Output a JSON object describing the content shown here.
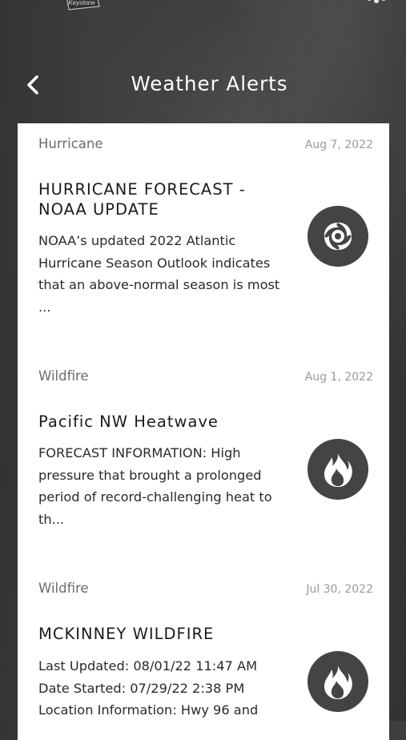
{
  "header": {
    "title": "Weather Alerts",
    "back_icon": "chevron-left-icon",
    "logo_text": "Keystone",
    "settings_icon": "gear-icon"
  },
  "colors": {
    "background": "#3a3c3e",
    "card": "#ffffff",
    "icon_circle": "#424446",
    "category_text": "#6b6b6b",
    "date_text": "#9a9a9a"
  },
  "alerts": [
    {
      "category": "Hurricane",
      "date": "Aug 7, 2022",
      "title": "HURRICANE FORECAST - NOAA UPDATE",
      "body": "NOAA’s updated 2022 Atlantic Hurricane Season Outlook indicates that an above-normal season is most ...",
      "icon": "hurricane-icon"
    },
    {
      "category": "Wildfire",
      "date": "Aug 1, 2022",
      "title": "Pacific NW Heatwave",
      "body": "FORECAST INFORMATION: High pressure that brought a prolonged period of record-challenging heat to th...",
      "icon": "fire-icon"
    },
    {
      "category": "Wildfire",
      "date": "Jul 30, 2022",
      "title": "MCKINNEY WILDFIRE",
      "body_lines": [
        "Last Updated: 08/01/22 11:47 AM",
        "Date Started: 07/29/22 2:38 PM",
        "Location Information: Hwy 96 and"
      ],
      "icon": "fire-icon"
    }
  ]
}
